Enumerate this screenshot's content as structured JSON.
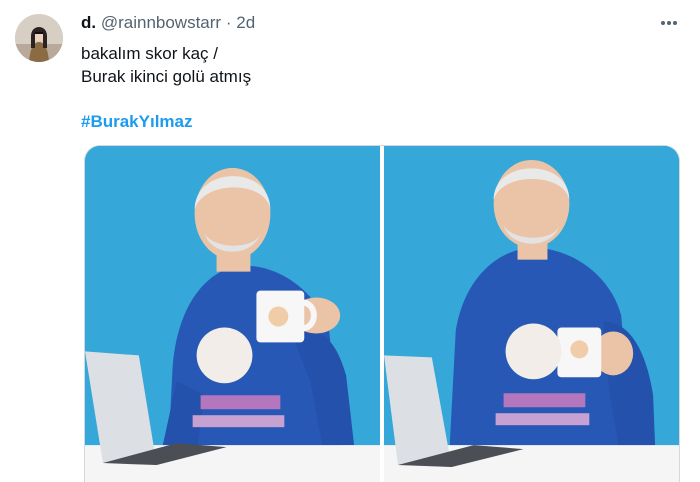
{
  "tweet": {
    "display_name": "d.",
    "handle": "@rainnbowstarr",
    "separator": "·",
    "time": "2d",
    "text_line1": "bakalım skor kaç /",
    "text_line2": "Burak ikinci golü atmış",
    "hashtag": "#BurakYılmaz",
    "more_icon": "more-horizontal-icon"
  },
  "colors": {
    "hashtag": "#1d9bf0",
    "photo_background": "#35a7d9",
    "shirt": "#2758b6"
  }
}
